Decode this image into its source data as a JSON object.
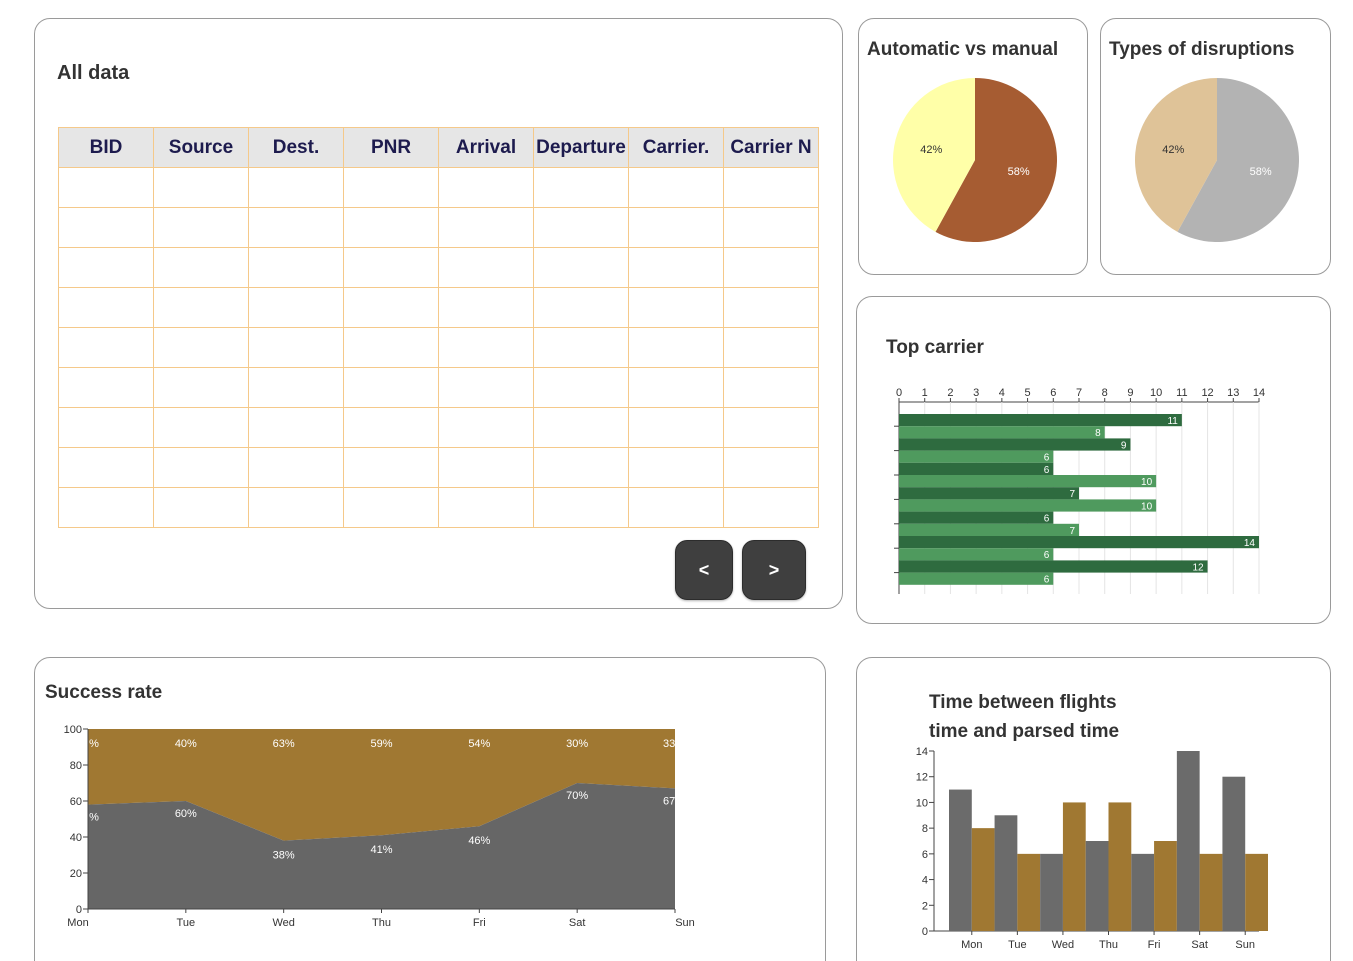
{
  "data_table": {
    "title": "All data",
    "columns": [
      "BID",
      "Source",
      "Dest.",
      "PNR",
      "Arrival",
      "Departure",
      "Carrier.",
      "Carrier N"
    ],
    "row_count": 9,
    "prev_label": "<",
    "next_label": ">"
  },
  "colors": {
    "table_border": "#f5c98a",
    "header_bg": "#e6e6e6",
    "header_text": "#1d1b4e",
    "button_bg": "#3f3f3f",
    "bar_dark": "#2e6b3f",
    "bar_light": "#4f9a5e",
    "area_gray": "#666666",
    "area_gold": "#a07832",
    "bar_gray": "#6b6b6b",
    "bar_gold": "#a07832"
  },
  "chart_data": [
    {
      "id": "automatic-vs-manual",
      "type": "pie",
      "title": "Automatic vs manual",
      "slices": [
        {
          "value": 58,
          "label": "58%",
          "color": "#a65c32"
        },
        {
          "value": 42,
          "label": "42%",
          "color": "#ffffa8"
        }
      ]
    },
    {
      "id": "types-of-disruptions",
      "type": "pie",
      "title": "Types of disruptions",
      "slices": [
        {
          "value": 58,
          "label": "58%",
          "color": "#b3b3b3"
        },
        {
          "value": 42,
          "label": "42%",
          "color": "#dfc398"
        }
      ]
    },
    {
      "id": "top-carrier",
      "type": "bar",
      "orientation": "horizontal",
      "title": "Top carrier",
      "xlim": [
        0,
        14
      ],
      "ticks": [
        0,
        1,
        2,
        3,
        4,
        5,
        6,
        7,
        8,
        9,
        10,
        11,
        12,
        13,
        14
      ],
      "values": [
        11,
        8,
        9,
        6,
        6,
        10,
        7,
        10,
        6,
        7,
        14,
        6,
        12,
        6
      ]
    },
    {
      "id": "success-rate",
      "type": "area",
      "stacked": true,
      "title": "Success rate",
      "categories": [
        "Mon",
        "Tue",
        "Wed",
        "Thu",
        "Fri",
        "Sat",
        "Sun"
      ],
      "ylim": [
        0,
        100
      ],
      "yticks": [
        0,
        20,
        40,
        60,
        80,
        100
      ],
      "series": [
        {
          "values": [
            58,
            60,
            38,
            41,
            46,
            70,
            67
          ],
          "labels": [
            "%",
            "60%",
            "38%",
            "41%",
            "46%",
            "70%",
            "67"
          ],
          "color": "#666666"
        },
        {
          "values": [
            42,
            40,
            62,
            59,
            54,
            30,
            33
          ],
          "labels": [
            "%",
            "40%",
            "63%",
            "59%",
            "54%",
            "30%",
            "33"
          ],
          "color": "#a07832"
        }
      ]
    },
    {
      "id": "time-between-flights",
      "type": "bar",
      "title_lines": [
        "Time between flights",
        "time and parsed time"
      ],
      "categories": [
        "Mon",
        "Tue",
        "Wed",
        "Thu",
        "Fri",
        "Sat",
        "Sun"
      ],
      "ylim": [
        0,
        14
      ],
      "yticks": [
        0,
        2,
        4,
        6,
        8,
        10,
        12,
        14
      ],
      "series": [
        {
          "values": [
            11,
            9,
            6,
            7,
            6,
            14,
            12
          ],
          "color": "#6b6b6b"
        },
        {
          "values": [
            8,
            6,
            10,
            10,
            7,
            6,
            6
          ],
          "color": "#a07832"
        }
      ]
    }
  ]
}
